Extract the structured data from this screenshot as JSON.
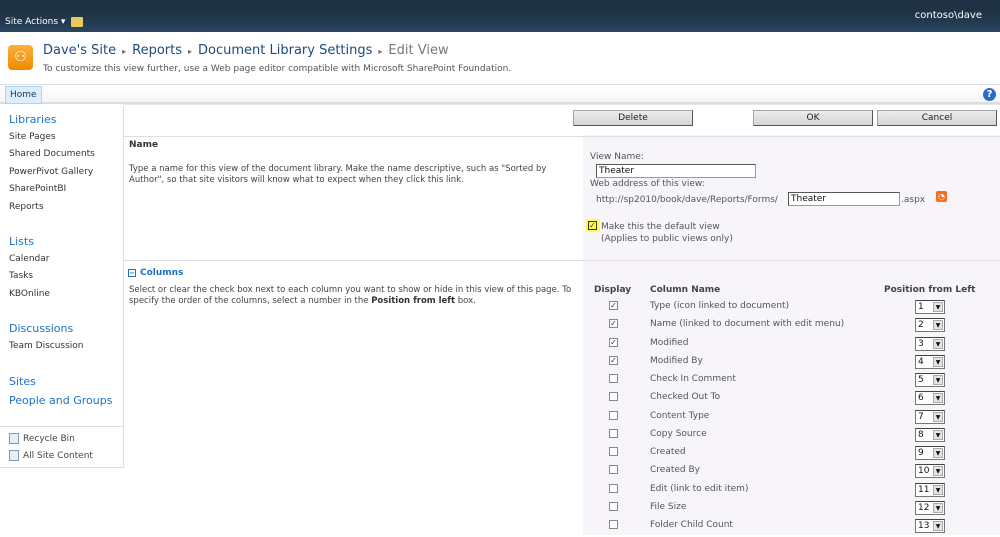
{
  "topbar": {
    "site_actions": "Site Actions ▾",
    "user": "contoso\\dave"
  },
  "title": {
    "breadcrumb": [
      "Dave's Site",
      "Reports",
      "Document Library Settings"
    ],
    "current": "Edit View",
    "subtitle": "To customize this view further, use a Web page editor compatible with Microsoft SharePoint Foundation."
  },
  "tabs": {
    "home": "Home",
    "help": "?"
  },
  "leftnav": {
    "libraries": "Libraries",
    "library_items": [
      "Site Pages",
      "Shared Documents",
      "PowerPivot Gallery",
      "SharePointBI",
      "Reports"
    ],
    "lists": "Lists",
    "list_items": [
      "Calendar",
      "Tasks",
      "KBOnline"
    ],
    "discussions": "Discussions",
    "discussion_items": [
      "Team Discussion"
    ],
    "sites": "Sites",
    "people": "People and Groups",
    "recycle": "Recycle Bin",
    "all_content": "All Site Content"
  },
  "buttons": {
    "delete": "Delete",
    "ok": "OK",
    "cancel": "Cancel"
  },
  "name_section": {
    "heading": "Name",
    "description": "Type a name for this view of the document library. Make the name descriptive, such as \"Sorted by Author\", so that site visitors will know what to expect when they click this link.",
    "view_name_label": "View Name:",
    "view_name": "Theater",
    "web_address_label": "Web address of this view:",
    "url_prefix": "http://sp2010/book/dave/Reports/Forms/",
    "url_name": "Theater",
    "url_suffix": ".aspx",
    "default_label": "Make this the default view",
    "default_note": "(Applies to public views only)",
    "default_checked": true
  },
  "columns_section": {
    "heading": "Columns",
    "description_pre": "Select or clear the check box next to each column you want to show or hide in this view of this page. To specify the order of the columns, select a number in the ",
    "description_bold": "Position from left",
    "description_post": " box.",
    "headers": {
      "display": "Display",
      "name": "Column Name",
      "position": "Position from Left"
    },
    "rows": [
      {
        "name": "Type (icon linked to document)",
        "checked": true,
        "position": "1"
      },
      {
        "name": "Name (linked to document with edit menu)",
        "checked": true,
        "position": "2"
      },
      {
        "name": "Modified",
        "checked": true,
        "position": "3"
      },
      {
        "name": "Modified By",
        "checked": true,
        "position": "4"
      },
      {
        "name": "Check In Comment",
        "checked": false,
        "position": "5"
      },
      {
        "name": "Checked Out To",
        "checked": false,
        "position": "6"
      },
      {
        "name": "Content Type",
        "checked": false,
        "position": "7"
      },
      {
        "name": "Copy Source",
        "checked": false,
        "position": "8"
      },
      {
        "name": "Created",
        "checked": false,
        "position": "9"
      },
      {
        "name": "Created By",
        "checked": false,
        "position": "10"
      },
      {
        "name": "Edit (link to edit item)",
        "checked": false,
        "position": "11"
      },
      {
        "name": "File Size",
        "checked": false,
        "position": "12"
      },
      {
        "name": "Folder Child Count",
        "checked": false,
        "position": "13"
      }
    ]
  }
}
